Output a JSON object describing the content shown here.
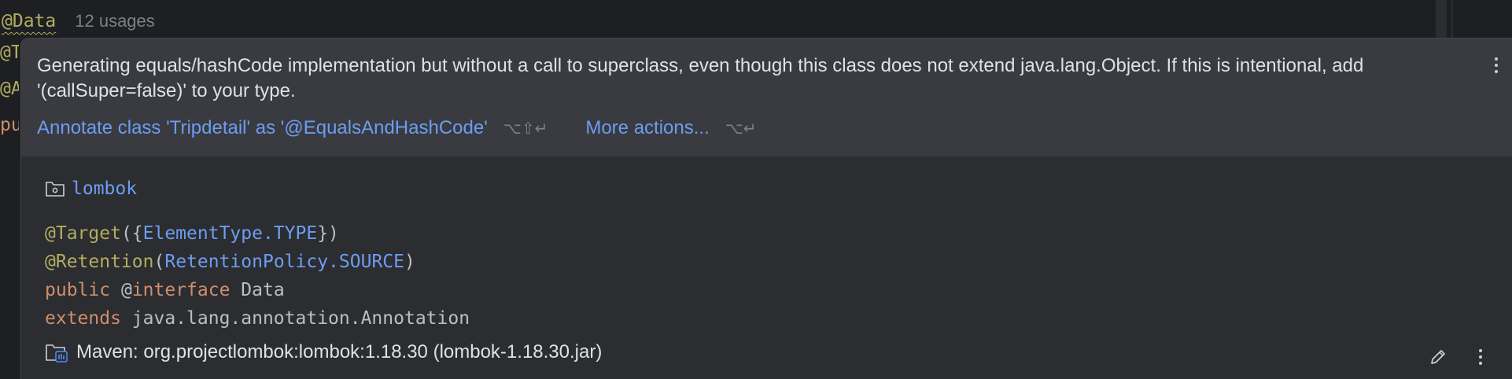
{
  "editor": {
    "annotation": "@Data",
    "usages": "12 usages",
    "fragments": [
      "@T",
      "@A",
      "pu"
    ]
  },
  "popup": {
    "message": "Generating equals/hashCode implementation but without a call to superclass, even though this class does not extend java.lang.Object. If this is intentional, add '(callSuper=false)' to your type.",
    "actions": [
      {
        "label": "Annotate class 'Tripdetail' as '@EqualsAndHashCode'",
        "shortcut": "⌥⇧↵"
      },
      {
        "label": "More actions...",
        "shortcut": "⌥↵"
      }
    ],
    "more_icon": "more-vertical-icon"
  },
  "doc": {
    "package": "lombok",
    "package_icon": "package-folder-icon",
    "code": {
      "line1": {
        "open": "({",
        "target_anno": "@Target",
        "element_type": "ElementType.TYPE",
        "close": "})"
      },
      "line2": {
        "retention_anno": "@Retention",
        "open": "(",
        "policy": "RetentionPolicy.SOURCE",
        "close": ")"
      },
      "line3": {
        "public_kw": "public",
        "at": "@",
        "interface_kw": "interface",
        "name": "Data"
      },
      "line4": {
        "extends_kw": "extends",
        "type": "java.lang.annotation.Annotation"
      }
    },
    "footer": {
      "library": "Maven: org.projectlombok:lombok:1.18.30 (lombok-1.18.30.jar)",
      "library_icon": "library-folder-icon",
      "edit_icon": "pencil-icon",
      "more_icon": "more-vertical-icon"
    }
  },
  "colors": {
    "editor_bg": "#1e1f22",
    "popup_bg": "#2b2d30",
    "popup_header_bg": "#393b40",
    "link": "#6e9cf1",
    "annotation": "#b3ae60",
    "keyword": "#cf8e6d",
    "text": "#dfe1e5",
    "muted": "#7e8085"
  }
}
